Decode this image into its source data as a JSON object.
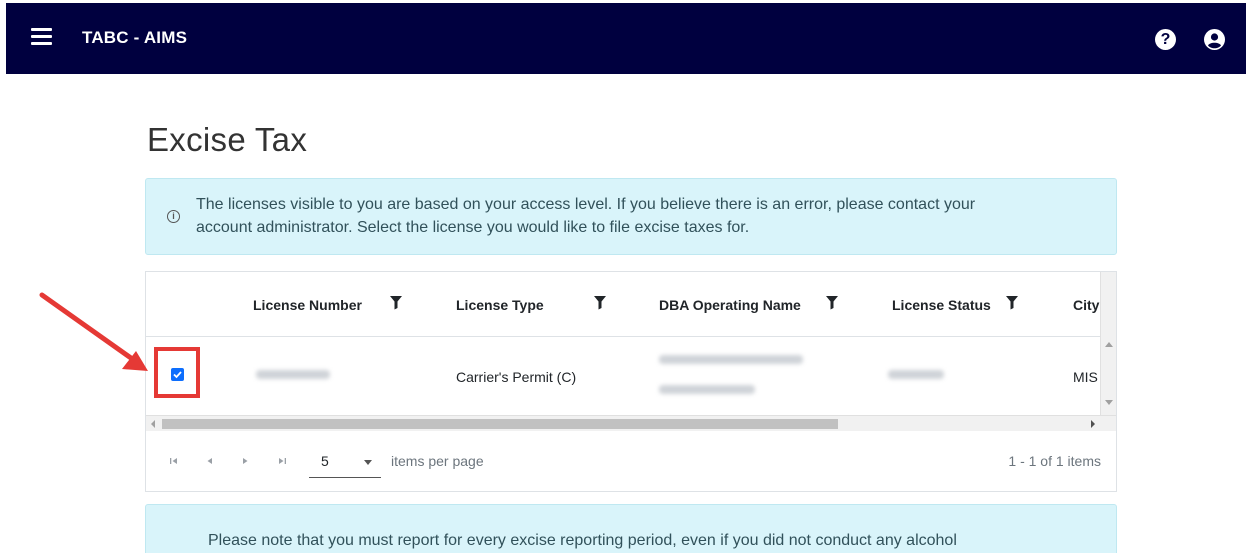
{
  "app": {
    "title": "TABC - AIMS"
  },
  "header": {
    "menu_icon": "hamburger-menu-icon",
    "help_icon": "question-circle-icon",
    "help_glyph": "?",
    "user_icon": "user-circle-icon"
  },
  "page": {
    "title": "Excise Tax"
  },
  "info": {
    "icon": "info-circle-icon",
    "line1": "The licenses visible to you are based on your access level. If you believe there is an error, please contact your",
    "line2": "account administrator. Select the license you would like to file excise taxes for."
  },
  "grid": {
    "columns": [
      {
        "label": "License Number"
      },
      {
        "label": "License Type"
      },
      {
        "label": "DBA Operating Name"
      },
      {
        "label": "License Status"
      },
      {
        "label": "City"
      }
    ],
    "rows": [
      {
        "selected": true,
        "license_number": "[redacted]",
        "license_type": "Carrier's Permit (C)",
        "dba": "[redacted]",
        "status": "[redacted]",
        "city": "MIS"
      }
    ]
  },
  "pager": {
    "page_size": "5",
    "items_per_page_label": "items per page",
    "info": "1 - 1 of 1 items"
  },
  "note": {
    "text": "Please note that you must report for every excise reporting period, even if you did not conduct any alcohol"
  },
  "colors": {
    "navbar": "#00003f",
    "info_bg": "#d9f4fa",
    "checkbox": "#0d6efd",
    "annotation": "#e53935"
  }
}
